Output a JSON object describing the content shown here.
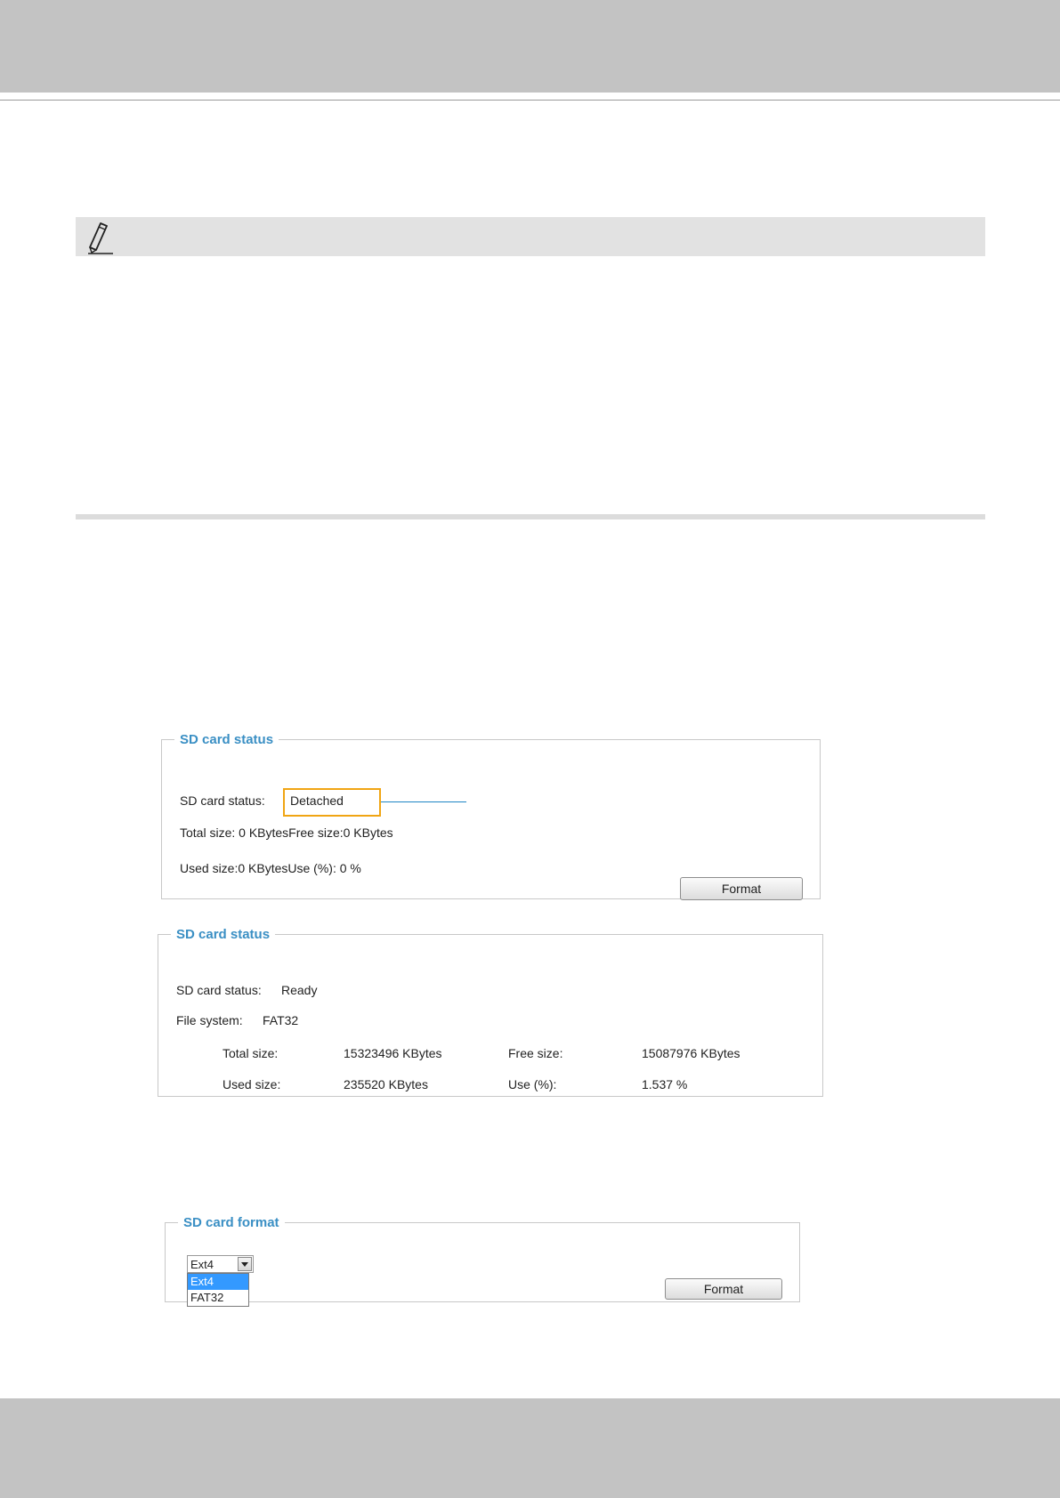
{
  "icons": {
    "note": "pencil-icon",
    "dropdown_arrow": "chevron-down-icon"
  },
  "colors": {
    "legend_text": "#3a8fc4",
    "highlight_box": "#f0a513",
    "callout_line": "#1e84c4",
    "selected_option": "#3399ff"
  },
  "panel_detached": {
    "legend": "SD card status",
    "status_label": "SD card status:",
    "status_value": "Detached",
    "total_size_line": "Total size: 0  KBytesFree size:0  KBytes",
    "used_size_line": "Used size:0  KBytesUse (%):  0 %",
    "format_button": "Format"
  },
  "panel_ready": {
    "legend": "SD card status",
    "status_label": "SD card status:",
    "status_value": "Ready",
    "fs_label": "File system:",
    "fs_value": "FAT32",
    "total_label": "Total size:",
    "total_value": "15323496  KBytes",
    "free_label": "Free size:",
    "free_value": "15087976  KBytes",
    "used_label": "Used size:",
    "used_value": "235520  KBytes",
    "use_pct_label": "Use (%):",
    "use_pct_value": "1.537 %"
  },
  "panel_format": {
    "legend": "SD card format",
    "select_value": "Ext4",
    "options": [
      "Ext4",
      "FAT32"
    ],
    "format_button": "Format"
  }
}
